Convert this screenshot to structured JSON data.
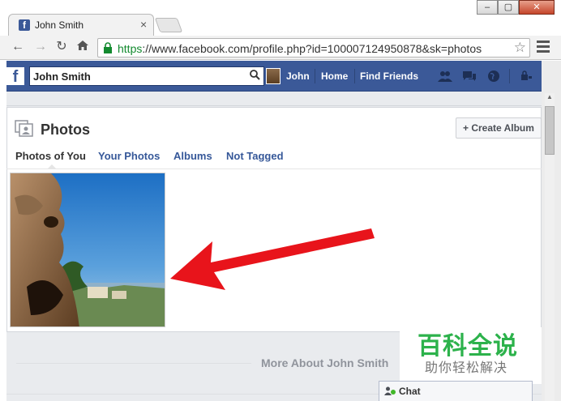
{
  "browser": {
    "tab_title": "John Smith",
    "favicon_letter": "f",
    "close_glyph": "×",
    "url_scheme": "https",
    "url_rest": "://www.facebook.com/profile.php?id=100007124950878&sk=photos",
    "window_buttons": [
      "–",
      "▢",
      "✕"
    ]
  },
  "facebook": {
    "logo_letter": "f",
    "search_value": "John Smith",
    "nav": {
      "user": "John",
      "home": "Home",
      "find_friends": "Find Friends"
    }
  },
  "photos": {
    "title": "Photos",
    "create_album": "+ Create Album",
    "tabs": [
      "Photos of You",
      "Your Photos",
      "Albums",
      "Not Tagged"
    ]
  },
  "more_about": "More About John Smith",
  "watermark": {
    "main": "百科全说",
    "sub": "助你轻松解决"
  },
  "chat": {
    "label": "Chat"
  },
  "colors": {
    "facebook_blue": "#3b5998",
    "link_blue": "#365899",
    "arrow_red": "#e8141b",
    "online_green": "#42b72a"
  }
}
